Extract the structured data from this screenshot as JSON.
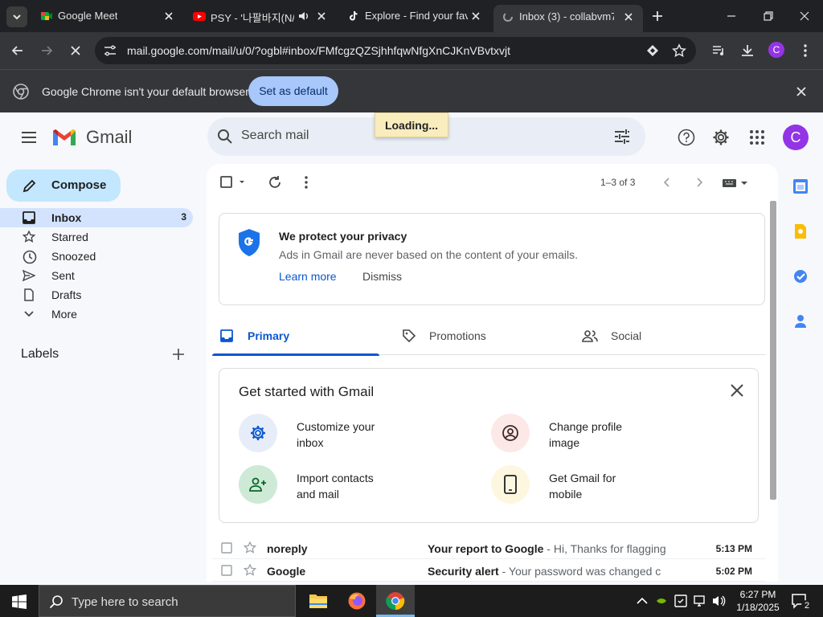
{
  "browser": {
    "tabs": [
      {
        "title": "Google Meet",
        "icon": "google-meet-icon"
      },
      {
        "title": "PSY - '나팔바지(N/",
        "icon": "youtube-icon"
      },
      {
        "title": "Explore - Find your fav",
        "icon": "tiktok-icon"
      },
      {
        "title": "Inbox (3) - collabvm7",
        "icon": "gmail-loading-icon"
      }
    ],
    "url": "mail.google.com/mail/u/0/?ogbl#inbox/FMfcgzQZSjhhfqwNfgXnCJKnVBvtxvjt",
    "profile_initial": "C",
    "infobar": {
      "message": "Google Chrome isn't your default browser",
      "button": "Set as default"
    }
  },
  "gmail": {
    "logo_text": "Gmail",
    "search_placeholder": "Search mail",
    "loading": "Loading...",
    "avatar_initial": "C",
    "compose": "Compose",
    "nav": [
      {
        "label": "Inbox",
        "count": "3",
        "icon": "inbox-icon"
      },
      {
        "label": "Starred",
        "count": "",
        "icon": "star-icon"
      },
      {
        "label": "Snoozed",
        "count": "",
        "icon": "clock-icon"
      },
      {
        "label": "Sent",
        "count": "",
        "icon": "send-icon"
      },
      {
        "label": "Drafts",
        "count": "",
        "icon": "draft-icon"
      },
      {
        "label": "More",
        "count": "",
        "icon": "chevron-down-icon"
      }
    ],
    "labels_heading": "Labels",
    "pagination": "1–3 of 3",
    "privacy": {
      "title": "We protect your privacy",
      "description": "Ads in Gmail are never based on the content of your emails.",
      "learn_more": "Learn more",
      "dismiss": "Dismiss"
    },
    "tabs": [
      {
        "label": "Primary",
        "icon": "inbox-icon"
      },
      {
        "label": "Promotions",
        "icon": "tag-icon"
      },
      {
        "label": "Social",
        "icon": "people-icon"
      }
    ],
    "get_started": {
      "title": "Get started with Gmail",
      "items": [
        {
          "line1": "Customize your",
          "line2": "inbox",
          "icon": "gear-icon"
        },
        {
          "line1": "Change profile",
          "line2": "image",
          "icon": "account-circle-icon"
        },
        {
          "line1": "Import contacts",
          "line2": "and mail",
          "icon": "person-add-icon"
        },
        {
          "line1": "Get Gmail for",
          "line2": "mobile",
          "icon": "phone-icon"
        }
      ]
    },
    "emails": [
      {
        "sender": "noreply",
        "subject": "Your report to Google",
        "snippet": " - Hi, Thanks for flagging",
        "time": "5:13 PM"
      },
      {
        "sender": "Google",
        "subject": "Security alert",
        "snippet": " - Your password was changed c",
        "time": "5:02 PM"
      }
    ]
  },
  "taskbar": {
    "search_placeholder": "Type here to search",
    "time": "6:27 PM",
    "date": "1/18/2025",
    "notification_count": "2"
  },
  "colors": {
    "accent": "#0b57d0",
    "compose_bg": "#c2e7ff",
    "avatar": "#9334e6"
  }
}
